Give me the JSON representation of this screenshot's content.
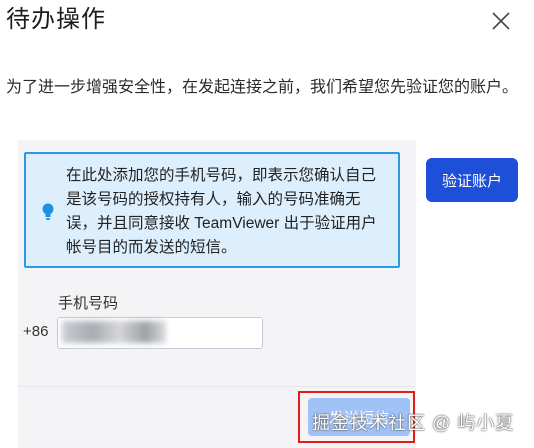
{
  "dialog": {
    "title": "待办操作",
    "close_icon": "close-icon"
  },
  "intro": {
    "text": "为了进一步增强安全性，在发起连接之前，我们希望您先验证您的账户。"
  },
  "info": {
    "icon": "lightbulb-icon",
    "text": "在此处添加您的手机号码，即表示您确认自己是该号码的授权持有人，输入的号码准确无误，并且同意接收 TeamViewer 出于验证用户帐号目的而发送的短信。"
  },
  "verify_button": {
    "label": "验证账户"
  },
  "phone": {
    "label": "手机号码",
    "country_code": "+86",
    "value": ""
  },
  "send_button": {
    "label": "发送短信"
  },
  "watermark": {
    "text": "掘金技术社区 @ 屿小夏"
  },
  "colors": {
    "primary": "#1d4fd8",
    "info_bg": "#ddeefc",
    "info_border": "#2b9ae0",
    "disabled_button": "#9fc2f7",
    "highlight": "#e21b1b"
  }
}
